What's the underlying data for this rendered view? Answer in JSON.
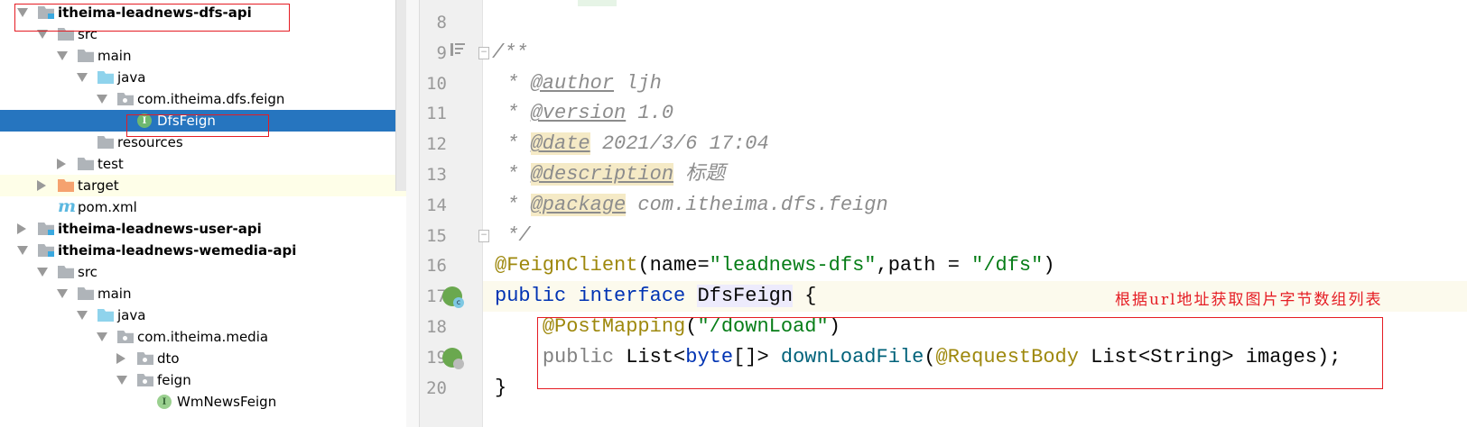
{
  "tree": {
    "items": [
      {
        "label": "itheima-leadnews-dfs-api",
        "depth": 0,
        "arrow": "down",
        "icon": "module",
        "bold": true
      },
      {
        "label": "src",
        "depth": 1,
        "arrow": "down",
        "icon": "folder"
      },
      {
        "label": "main",
        "depth": 2,
        "arrow": "down",
        "icon": "folder"
      },
      {
        "label": "java",
        "depth": 3,
        "arrow": "down",
        "icon": "java"
      },
      {
        "label": "com.itheima.dfs.feign",
        "depth": 4,
        "arrow": "down",
        "icon": "pkg"
      },
      {
        "label": "DfsFeign",
        "depth": 5,
        "arrow": "",
        "icon": "interface",
        "selected": true
      },
      {
        "label": "resources",
        "depth": 3,
        "arrow": "",
        "icon": "resources"
      },
      {
        "label": "test",
        "depth": 2,
        "arrow": "right",
        "icon": "folder"
      },
      {
        "label": "target",
        "depth": 1,
        "arrow": "right",
        "icon": "orange",
        "highlight": true
      },
      {
        "label": "pom.xml",
        "depth": 1,
        "arrow": "",
        "icon": "maven"
      },
      {
        "label": "itheima-leadnews-user-api",
        "depth": 0,
        "arrow": "right",
        "icon": "module",
        "bold": true
      },
      {
        "label": "itheima-leadnews-wemedia-api",
        "depth": 0,
        "arrow": "down",
        "icon": "module",
        "bold": true
      },
      {
        "label": "src",
        "depth": 1,
        "arrow": "down",
        "icon": "folder"
      },
      {
        "label": "main",
        "depth": 2,
        "arrow": "down",
        "icon": "folder"
      },
      {
        "label": "java",
        "depth": 3,
        "arrow": "down",
        "icon": "java"
      },
      {
        "label": "com.itheima.media",
        "depth": 4,
        "arrow": "down",
        "icon": "pkg"
      },
      {
        "label": "dto",
        "depth": 5,
        "arrow": "right",
        "icon": "pkg"
      },
      {
        "label": "feign",
        "depth": 5,
        "arrow": "down",
        "icon": "pkg"
      },
      {
        "label": "WmNewsFeign",
        "depth": 6,
        "arrow": "",
        "icon": "interface-light"
      }
    ],
    "interface_glyph": "I",
    "maven_glyph": "m"
  },
  "editor": {
    "lines": [
      {
        "n": "8",
        "seg": []
      },
      {
        "n": "9",
        "seg": [
          [
            "/**",
            "c"
          ]
        ]
      },
      {
        "n": "10",
        "seg": [
          [
            " * ",
            "c"
          ],
          [
            "@author",
            "tag"
          ],
          [
            " ljh",
            "c"
          ]
        ]
      },
      {
        "n": "11",
        "seg": [
          [
            " * ",
            "c"
          ],
          [
            "@version",
            "tag"
          ],
          [
            " 1.0",
            "c"
          ]
        ]
      },
      {
        "n": "12",
        "seg": [
          [
            " * ",
            "c"
          ],
          [
            "@date",
            "tag tagbg"
          ],
          [
            " 2021/3/6 17:04",
            "c"
          ]
        ]
      },
      {
        "n": "13",
        "seg": [
          [
            " * ",
            "c"
          ],
          [
            "@description",
            "tag tagbg"
          ],
          [
            " 标题",
            "c"
          ]
        ]
      },
      {
        "n": "14",
        "seg": [
          [
            " * ",
            "c"
          ],
          [
            "@package",
            "tag tagbg"
          ],
          [
            " com.itheima.dfs.feign",
            "c"
          ]
        ]
      },
      {
        "n": "15",
        "seg": [
          [
            " */",
            "c"
          ]
        ]
      },
      {
        "n": "16",
        "seg": [
          [
            "@FeignClient",
            "an"
          ],
          [
            "(name=",
            ""
          ],
          [
            "\"leadnews-dfs\"",
            "s"
          ],
          [
            ",path = ",
            ""
          ],
          [
            "\"/dfs\"",
            "s"
          ],
          [
            ")",
            ""
          ]
        ]
      },
      {
        "n": "17",
        "seg": [
          [
            "public",
            "k"
          ],
          [
            " ",
            ""
          ],
          [
            "interface",
            "k"
          ],
          [
            " ",
            ""
          ],
          [
            "DfsFeign",
            "idhl"
          ],
          [
            " {",
            ""
          ]
        ]
      },
      {
        "n": "18",
        "seg": [
          [
            "    ",
            ""
          ],
          [
            "@PostMapping",
            "an"
          ],
          [
            "(",
            ""
          ],
          [
            "\"/downLoad\"",
            "s"
          ],
          [
            ")",
            ""
          ]
        ]
      },
      {
        "n": "19",
        "seg": [
          [
            "    ",
            ""
          ],
          [
            "public",
            "g"
          ],
          [
            " List<",
            ""
          ],
          [
            "byte",
            "k"
          ],
          [
            "[]> ",
            ""
          ],
          [
            "downLoadFile",
            "m"
          ],
          [
            "(",
            ""
          ],
          [
            "@RequestBody",
            "an"
          ],
          [
            " List<String> images);",
            ""
          ]
        ]
      },
      {
        "n": "20",
        "seg": [
          [
            "}",
            ""
          ]
        ]
      }
    ],
    "annotation_note": "根据url地址获取图片字节数组列表",
    "gutter_badge": "c"
  }
}
